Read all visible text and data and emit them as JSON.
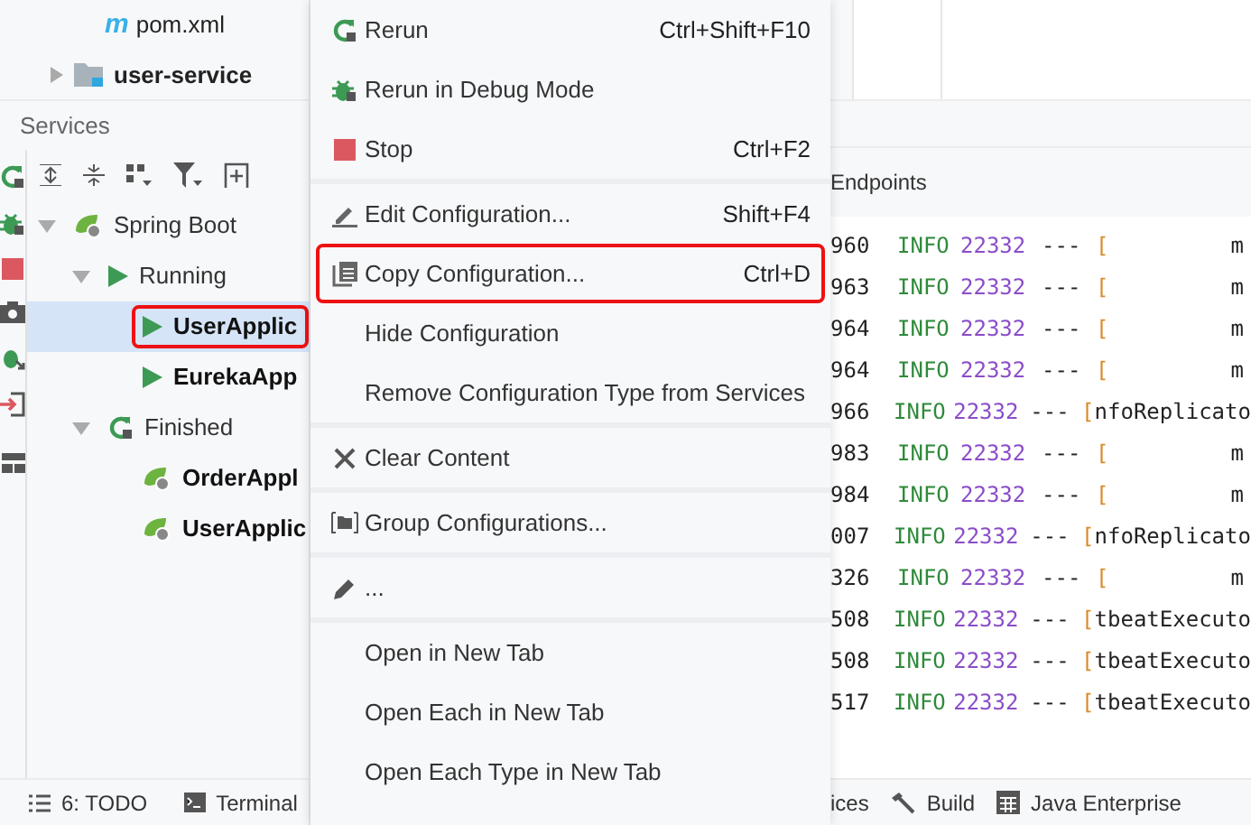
{
  "project_tree": [
    {
      "kind": "file",
      "logo": "m",
      "label": "pom.xml"
    },
    {
      "kind": "module",
      "label": "user-service"
    }
  ],
  "services": {
    "title": "Services",
    "tree": [
      {
        "label": "Spring Boot",
        "kind": "spring",
        "expanded": true,
        "selected": false,
        "highlighted": false,
        "children": [
          {
            "label": "Running",
            "kind": "run",
            "expanded": true,
            "selected": false,
            "highlighted": false,
            "children": [
              {
                "label": "UserApplic",
                "kind": "app-run",
                "selected": true,
                "highlighted": true
              },
              {
                "label": "EurekaApp",
                "kind": "app-run",
                "selected": false,
                "highlighted": false
              }
            ]
          },
          {
            "label": "Finished",
            "kind": "rerun",
            "expanded": true,
            "selected": false,
            "highlighted": false,
            "children": [
              {
                "label": "OrderAppl",
                "kind": "app-done",
                "selected": false,
                "highlighted": false
              },
              {
                "label": "UserApplic",
                "kind": "app-done",
                "selected": false,
                "highlighted": false
              }
            ]
          }
        ]
      }
    ]
  },
  "context_menu": [
    [
      {
        "label": "Rerun",
        "shortcut": "Ctrl+Shift+F10",
        "kind": "rerun",
        "highlighted": false
      },
      {
        "label": "Rerun in Debug Mode",
        "kind": "debug",
        "highlighted": false
      },
      {
        "label": "Stop",
        "shortcut": "Ctrl+F2",
        "kind": "stop",
        "highlighted": false
      }
    ],
    [
      {
        "label": "Edit Configuration...",
        "shortcut": "Shift+F4",
        "kind": "edit",
        "highlighted": false
      },
      {
        "label": "Copy Configuration...",
        "shortcut": "Ctrl+D",
        "kind": "copy",
        "highlighted": true
      },
      {
        "label": "Hide Configuration",
        "highlighted": false
      },
      {
        "label": "Remove Configuration Type from Services",
        "highlighted": false
      }
    ],
    [
      {
        "label": "Clear Content",
        "kind": "clear",
        "highlighted": false
      }
    ],
    [
      {
        "label": "Group Configurations...",
        "kind": "group",
        "highlighted": false
      }
    ],
    [
      {
        "label": "...",
        "kind": "pencil",
        "highlighted": false
      }
    ],
    [
      {
        "label": "Open in New Tab",
        "highlighted": false
      },
      {
        "label": "Open Each in New Tab",
        "highlighted": false
      },
      {
        "label": "Open Each Type in New Tab",
        "highlighted": false
      }
    ]
  ],
  "console": {
    "tab": "Endpoints",
    "rows": [
      {
        "time": "960",
        "level": "INFO",
        "pid": "22332",
        "sep": "---",
        "bracket": "[",
        "thread": "",
        "logger": "m"
      },
      {
        "time": "963",
        "level": "INFO",
        "pid": "22332",
        "sep": "---",
        "bracket": "[",
        "thread": "",
        "logger": "m"
      },
      {
        "time": "964",
        "level": "INFO",
        "pid": "22332",
        "sep": "---",
        "bracket": "[",
        "thread": "",
        "logger": "m"
      },
      {
        "time": "964",
        "level": "INFO",
        "pid": "22332",
        "sep": "---",
        "bracket": "[",
        "thread": "",
        "logger": "m"
      },
      {
        "time": "966",
        "level": "INFO",
        "pid": "22332",
        "sep": "---",
        "bracket": "[",
        "thread": "nfoReplicato",
        "logger": ""
      },
      {
        "time": "983",
        "level": "INFO",
        "pid": "22332",
        "sep": "---",
        "bracket": "[",
        "thread": "",
        "logger": "m"
      },
      {
        "time": "984",
        "level": "INFO",
        "pid": "22332",
        "sep": "---",
        "bracket": "[",
        "thread": "",
        "logger": "m"
      },
      {
        "time": "007",
        "level": "INFO",
        "pid": "22332",
        "sep": "---",
        "bracket": "[",
        "thread": "nfoReplicato",
        "logger": ""
      },
      {
        "time": "326",
        "level": "INFO",
        "pid": "22332",
        "sep": "---",
        "bracket": "[",
        "thread": "",
        "logger": "m"
      },
      {
        "time": "508",
        "level": "INFO",
        "pid": "22332",
        "sep": "---",
        "bracket": "[",
        "thread": "tbeatExecuto",
        "logger": ""
      },
      {
        "time": "508",
        "level": "INFO",
        "pid": "22332",
        "sep": "---",
        "bracket": "[",
        "thread": "tbeatExecuto",
        "logger": ""
      },
      {
        "time": "517",
        "level": "INFO",
        "pid": "22332",
        "sep": "---",
        "bracket": "[",
        "thread": "tbeatExecuto",
        "logger": ""
      }
    ]
  },
  "bottom_left": [
    {
      "kind": "list",
      "label": "6: TODO"
    },
    {
      "kind": "terminal",
      "label": "Terminal"
    }
  ],
  "bottom_right": [
    {
      "kind": "plain",
      "label": "ices"
    },
    {
      "kind": "hammer",
      "label": "Build"
    },
    {
      "kind": "grid",
      "label": "Java Enterprise"
    }
  ]
}
